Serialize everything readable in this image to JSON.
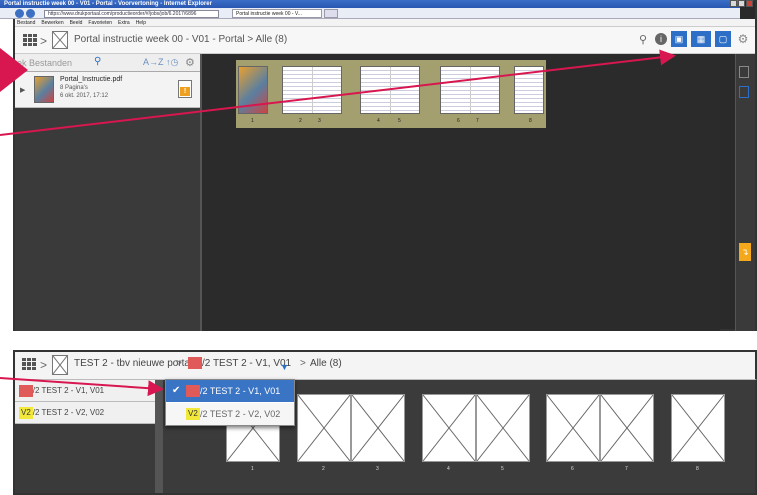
{
  "top": {
    "browser": {
      "title": "Portal instructie week 00 - V01 - Portal - Voorvertoning - Internet Explorer",
      "url": "https://www.drukportaal.com/productieorder/#/jobs/job/6.2017/6896",
      "tab_label": "Portal instructie week 00 - V...",
      "menu": [
        "Bestand",
        "Bewerken",
        "Beeld",
        "Favorieten",
        "Extra",
        "Help"
      ]
    },
    "header": {
      "breadcrumb_sep": ">",
      "path": "Portal instructie week 00 - V01 - Portal > Alle (8)",
      "info_icon": "info-icon",
      "view_icons": [
        "search-icon",
        "info-icon",
        "spread-view-icon",
        "grid-view-icon",
        "page-view-icon",
        "gear-icon"
      ]
    },
    "sidebar": {
      "search_placeholder": "ek Bestanden",
      "sort_label": "A→Z",
      "file": {
        "name": "Portal_Instructie.pdf",
        "pages": "8 Pagina's",
        "date": "6 okt. 2017, 17:12"
      }
    },
    "pages": [
      "1",
      "2",
      "3",
      "4",
      "5",
      "6",
      "7",
      "8"
    ]
  },
  "bottom": {
    "header": {
      "sep": ">",
      "title": "TEST 2 - tbv nieuwe portal",
      "current_version_badge": "V1",
      "current_version_text": "/2  TEST 2 - V1, V01",
      "alle": "Alle (8)"
    },
    "versions": [
      {
        "badge": "V1",
        "text": "/2  TEST 2 - V1, V01",
        "color": "#e05a5a"
      },
      {
        "badge": "V2",
        "text": "/2  TEST 2 - V2, V02",
        "color": "#f2e83a"
      }
    ],
    "dropdown": {
      "check": "✔",
      "items": [
        {
          "badge": "V1",
          "text": "/2  TEST 2 - V1, V01"
        },
        {
          "badge": "V2",
          "text": "/2  TEST 2 - V2, V02"
        }
      ]
    },
    "pages": [
      "1",
      "2",
      "3",
      "4",
      "5",
      "6",
      "7",
      "8"
    ]
  },
  "colors": {
    "accent": "#2d6fc6",
    "arrow": "#d8164f",
    "spread_bg": "#a39f6f",
    "warn": "#f4a81c"
  }
}
